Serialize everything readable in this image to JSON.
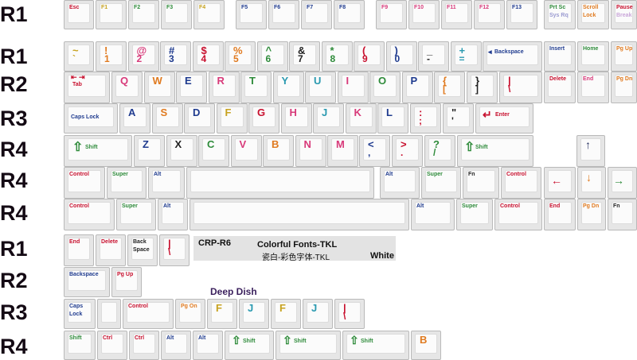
{
  "row_labels": [
    "R1",
    "R1",
    "R2",
    "R3",
    "R4",
    "R4",
    "R4",
    "R1",
    "R2",
    "R3",
    "R4"
  ],
  "info": {
    "code": "CRP-R6",
    "title": "Colorful Fonts-TKL",
    "title_cn": "瓷白-彩色字体-TKL",
    "variant": "White"
  },
  "deep_dish_label": "Deep Dish",
  "colors": {
    "red": "#c8102e",
    "green": "#2e8b3a",
    "blue": "#1f3b8f",
    "orange": "#e07a1f",
    "purple": "#7a2a8a",
    "pink": "#d83a7a",
    "teal": "#2a9ab0",
    "yellow": "#c7a21f"
  },
  "keys": {
    "esc": "Esc",
    "f1": "F1",
    "f2": "F2",
    "f3": "F3",
    "f4": "F4",
    "f5": "F5",
    "f6": "F6",
    "f7": "F7",
    "f8": "F8",
    "f9": "F9",
    "f10": "F10",
    "f11": "F11",
    "f12": "F12",
    "f13": "F13",
    "prtsc": "Prt Sc",
    "prtsc_sub": "Sys Rq",
    "scroll": "Scroll\nLock",
    "pause": "Pause",
    "pause_sub": "Break",
    "tilde": "~",
    "grave": "`",
    "n1a": "!",
    "n1": "1",
    "n2a": "@",
    "n2": "2",
    "n3a": "#",
    "n3": "3",
    "n4a": "$",
    "n4": "4",
    "n5a": "%",
    "n5": "5",
    "n6a": "^",
    "n6": "6",
    "n7a": "&",
    "n7": "7",
    "n8a": "*",
    "n8": "8",
    "n9a": "(",
    "n9": "9",
    "n0a": ")",
    "n0": "0",
    "mina": "_",
    "min": "-",
    "eqa": "+",
    "eq": "=",
    "backspace": "Backspace",
    "insert": "Insert",
    "home": "Home",
    "pgup": "Pg Up",
    "tab": "Tab",
    "q": "Q",
    "w": "W",
    "e": "E",
    "r": "R",
    "t": "T",
    "y": "Y",
    "u": "U",
    "i": "I",
    "o": "O",
    "p": "P",
    "lbra": "{",
    "lbr": "[",
    "rbra": "}",
    "rbr": "]",
    "pipe": "|",
    "bslash": "\\",
    "delete": "Delete",
    "end": "End",
    "pgdn": "Pg Dn",
    "caps": "Caps Lock",
    "a": "A",
    "s": "S",
    "d": "D",
    "f": "F",
    "g": "G",
    "h": "H",
    "j": "J",
    "k": "K",
    "l": "L",
    "cola": ":",
    "col": ";",
    "quoa": "\"",
    "quo": "'",
    "enter": "Enter",
    "shift": "Shift",
    "z": "Z",
    "x": "X",
    "c": "C",
    "v": "V",
    "b": "B",
    "n": "N",
    "m": "M",
    "lta": "<",
    "lt": ",",
    "gta": ">",
    "gt": ".",
    "qma": "?",
    "qm": "/",
    "control": "Control",
    "super": "Super",
    "alt": "Alt",
    "fn": "Fn",
    "ex_end": "End",
    "ex_delete": "Delete",
    "ex_back": "Back\nSpace",
    "ex_backspace": "Backspace",
    "ex_pgup": "Pg Up",
    "ex_caps": "Caps\nLock",
    "ex_control": "Control",
    "ex_pgon": "Pg On",
    "ex_f": "F",
    "ex_j": "J",
    "ex_ctrl": "Ctrl",
    "ex_b": "B"
  }
}
